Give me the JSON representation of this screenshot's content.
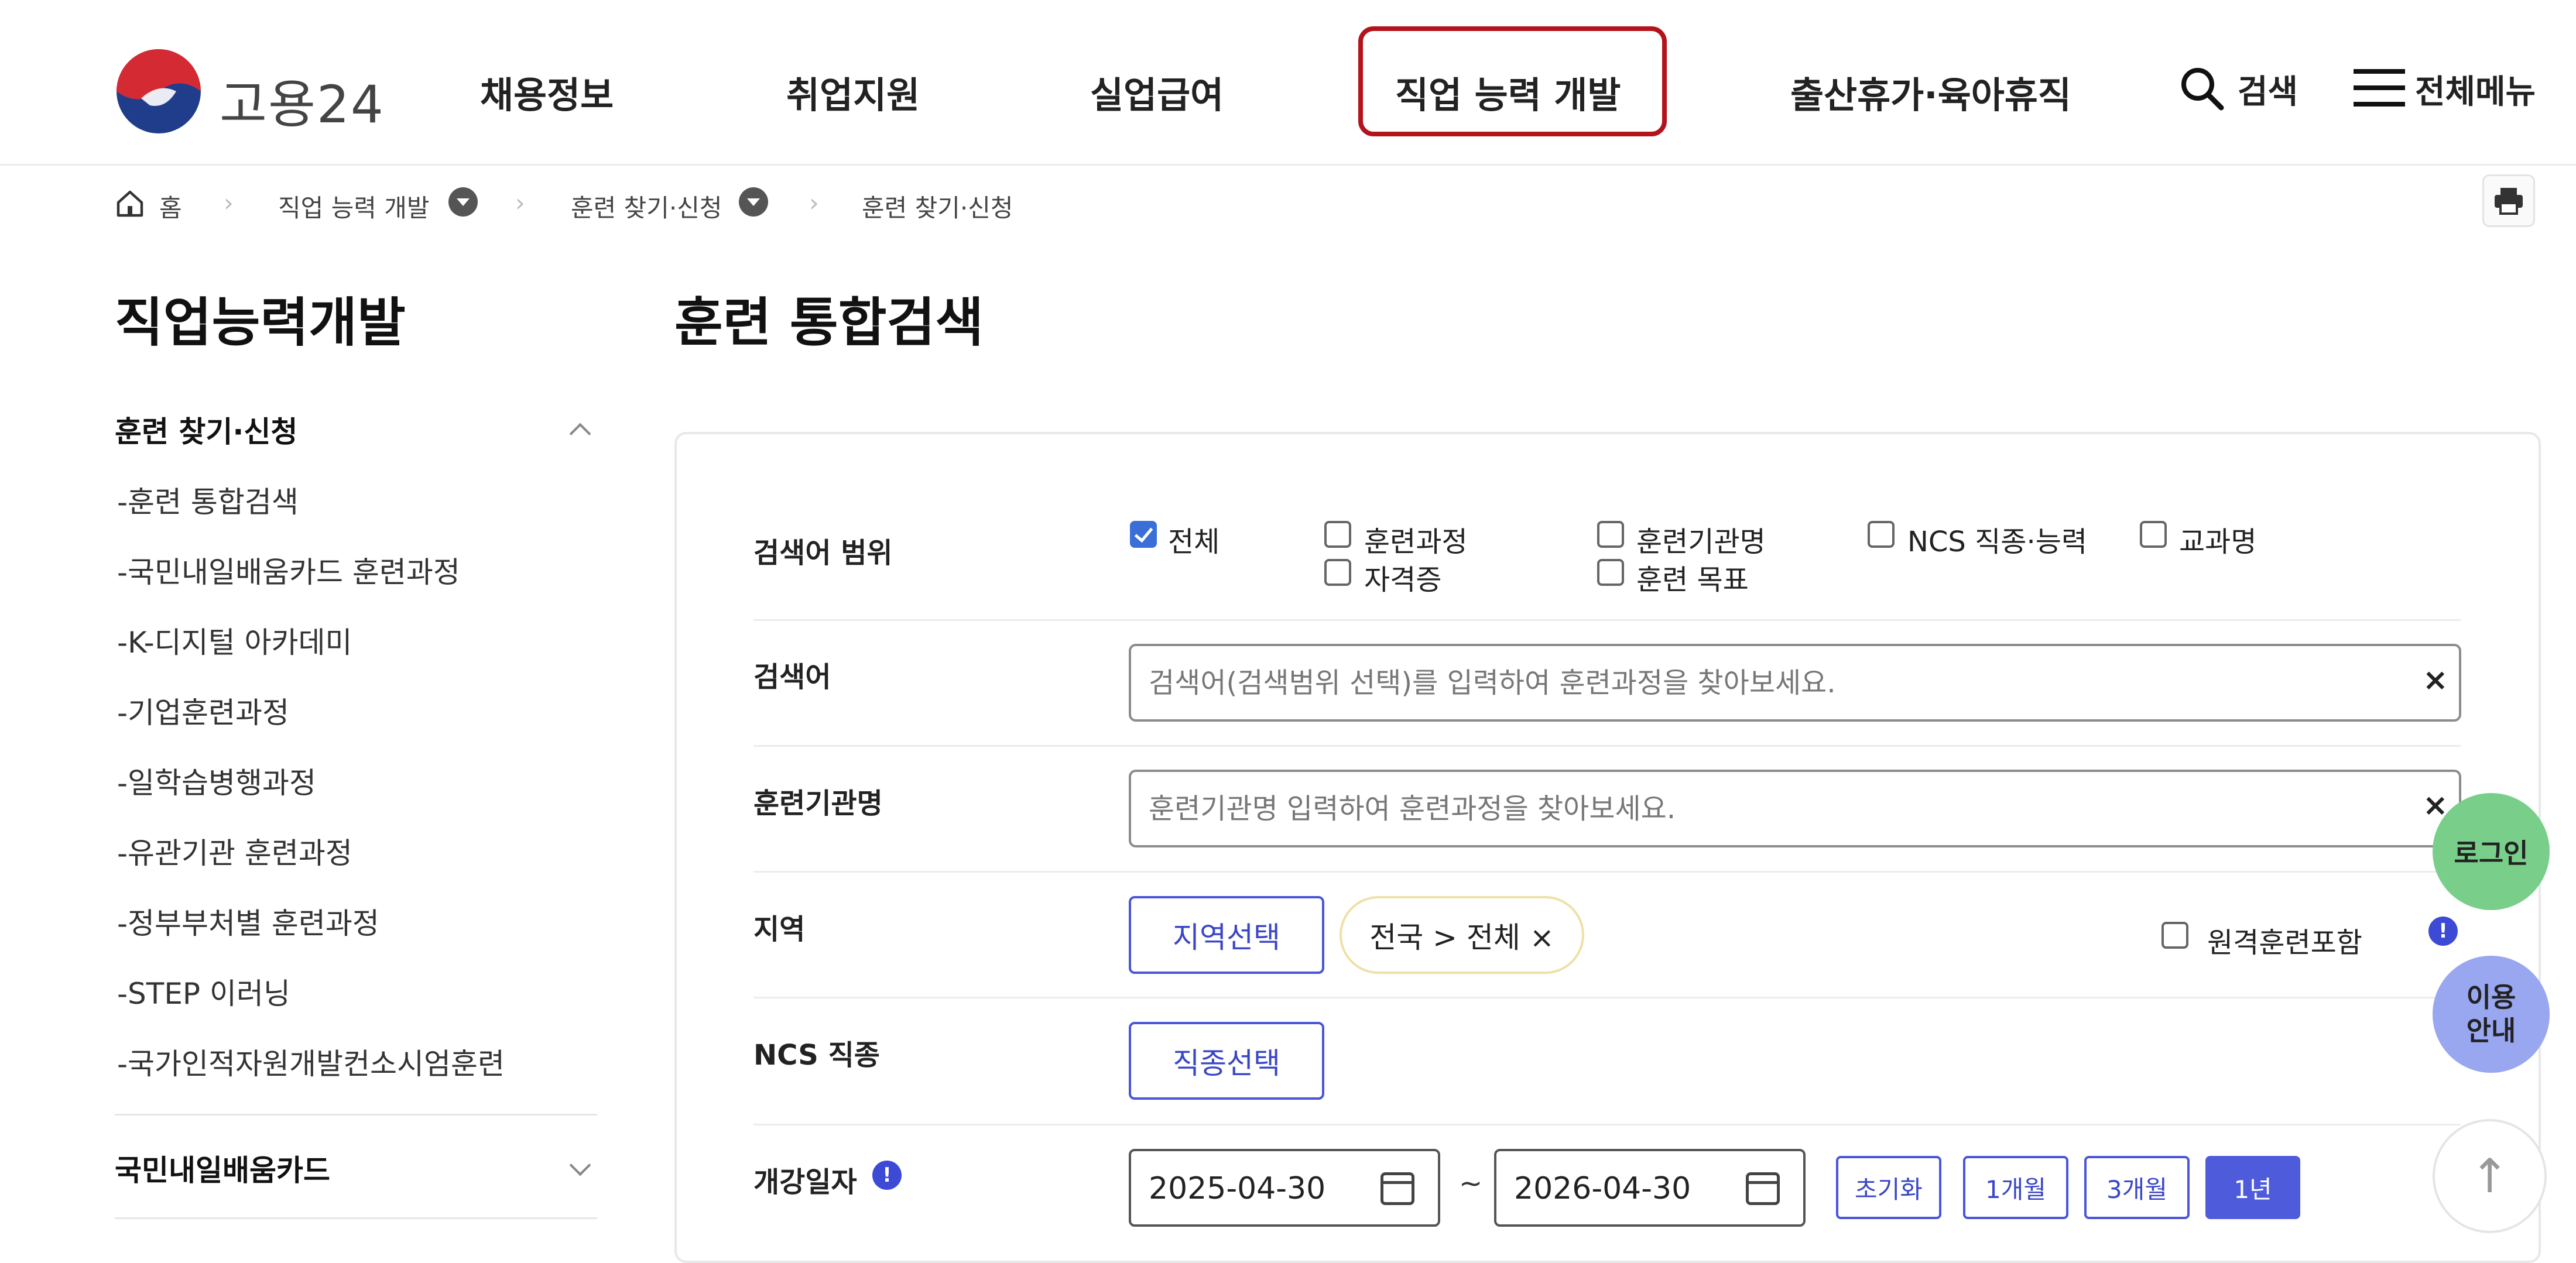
{
  "header": {
    "logo_text": "고용24",
    "nav": [
      "채용정보",
      "취업지원",
      "실업급여",
      "직업 능력 개발",
      "출산휴가·육아휴직"
    ],
    "active_nav_index": 3,
    "search_label": "검색",
    "menu_label": "전체메뉴"
  },
  "breadcrumb": {
    "home": "홈",
    "level1": "직업 능력 개발",
    "level2": "훈련 찾기·신청",
    "current": "훈련 찾기·신청"
  },
  "sidebar": {
    "title": "직업능력개발",
    "group1": "훈련 찾기·신청",
    "items": [
      "-훈련 통합검색",
      "-국민내일배움카드 훈련과정",
      "-K-디지털 아카데미",
      "-기업훈련과정",
      "-일학습병행과정",
      "-유관기관 훈련과정",
      "-정부부처별 훈련과정",
      "-STEP 이러닝",
      "-국가인적자원개발컨소시엄훈련"
    ],
    "group2": "국민내일배움카드"
  },
  "main": {
    "title": "훈련 통합검색",
    "scope": {
      "label": "검색어 범위",
      "options": [
        {
          "label": "전체",
          "checked": true
        },
        {
          "label": "훈련과정",
          "checked": false
        },
        {
          "label": "훈련기관명",
          "checked": false
        },
        {
          "label": "NCS 직종·능력",
          "checked": false
        },
        {
          "label": "교과명",
          "checked": false
        },
        {
          "label": "자격증",
          "checked": false
        },
        {
          "label": "훈련 목표",
          "checked": false
        }
      ]
    },
    "keyword": {
      "label": "검색어",
      "placeholder": "검색어(검색범위 선택)를 입력하여 훈련과정을 찾아보세요.",
      "clear": "×"
    },
    "institution": {
      "label": "훈련기관명",
      "placeholder": "훈련기관명 입력하여 훈련과정을 찾아보세요.",
      "clear": "×"
    },
    "region": {
      "label": "지역",
      "button": "지역선택",
      "chip": "전국 > 전체 ×",
      "remote_label": "원격훈련포함",
      "remote_checked": false
    },
    "ncs": {
      "label": "NCS 직종",
      "button": "직종선택"
    },
    "date": {
      "label": "개강일자",
      "start": "2025-04-30",
      "end": "2026-04-30",
      "tilde": "~",
      "quick": [
        "초기화",
        "1개월",
        "3개월",
        "1년"
      ],
      "active_quick_index": 3
    }
  },
  "floating": {
    "login": "로그인",
    "guide_line1": "이용",
    "guide_line2": "안내",
    "top_arrow": "↑"
  },
  "colors": {
    "accent_red": "#b3131b",
    "primary_blue": "#4e5cdc",
    "login_green": "#79cf8a",
    "guide_blue": "#99a6f0"
  }
}
